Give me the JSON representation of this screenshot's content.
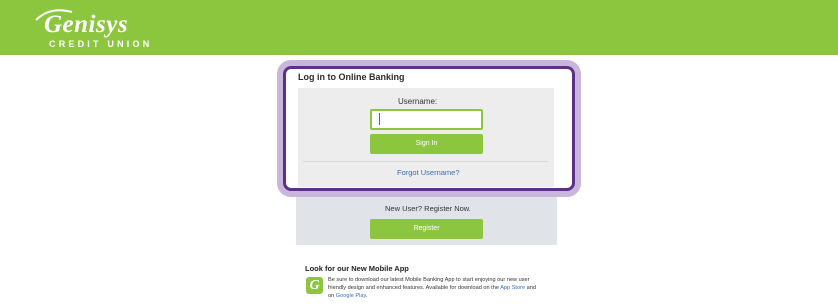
{
  "header": {
    "logo_name": "Genisys",
    "logo_subtitle": "CREDIT UNION",
    "brand_color": "#8cc63f"
  },
  "login": {
    "title": "Log in to Online Banking",
    "username_label": "Username:",
    "username_value": "",
    "signin_label": "Sign In",
    "forgot_label": "Forgot Username?",
    "highlight_color": "#5e2f86"
  },
  "register": {
    "prompt": "New User? Register Now.",
    "button_label": "Register"
  },
  "mobile": {
    "title": "Look for our New Mobile App",
    "icon_letter": "G",
    "text_before": "Be sure to download our latest Mobile Banking App to start enjoying our new user friendly design and enhanced features. Available for download on the ",
    "app_store": "App Store",
    "text_middle": " and on ",
    "google_play": "Google Play",
    "text_end": "."
  }
}
